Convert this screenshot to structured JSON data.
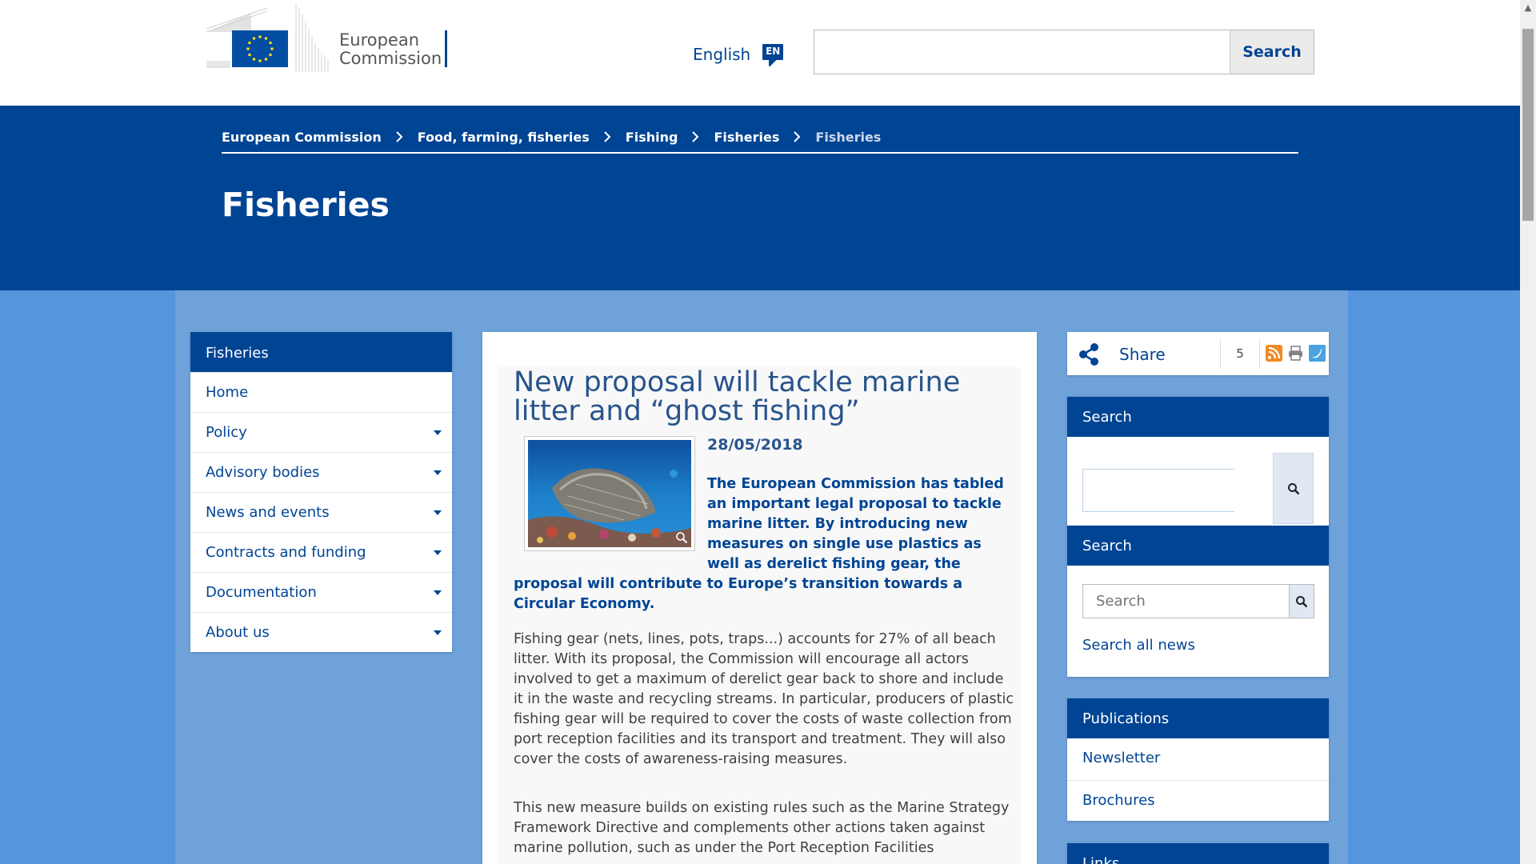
{
  "header": {
    "logo_line1": "European",
    "logo_line2": "Commission",
    "language": "English",
    "language_code": "EN",
    "search_button": "Search",
    "search_value": ""
  },
  "breadcrumb": [
    "European Commission",
    "Food, farming, fisheries",
    "Fishing",
    "Fisheries",
    "Fisheries"
  ],
  "page_title": "Fisheries",
  "sidenav": {
    "heading": "Fisheries",
    "items": [
      {
        "label": "Home",
        "expandable": false
      },
      {
        "label": "Policy",
        "expandable": true
      },
      {
        "label": "Advisory bodies",
        "expandable": true
      },
      {
        "label": "News and events",
        "expandable": true
      },
      {
        "label": "Contracts and funding",
        "expandable": true
      },
      {
        "label": "Documentation",
        "expandable": true
      },
      {
        "label": "About us",
        "expandable": true
      }
    ]
  },
  "article": {
    "title": "New proposal will tackle marine litter and “ghost fishing”",
    "date": "28/05/2018",
    "lead": "The European Commission has tabled an important legal proposal to tackle marine litter. By introducing new measures on single use plastics as well as derelict fishing gear, the proposal will contribute to Europe’s transition towards a Circular Economy.",
    "p1": "Fishing gear (nets, lines, pots, traps...) accounts for 27% of all beach litter. With its proposal, the Commission will encourage all actors involved to get a maximum of derelict gear back to shore and include it in the waste and recycling streams. In particular, producers of plastic fishing gear will be required to cover the costs of waste collection from port reception facilities and its transport and treatment. They will also cover the costs of awareness-raising measures.",
    "p2": "This new measure builds on existing rules such as the Marine Strategy Framework Directive and complements other actions taken against marine pollution, such as under the Port Reception Facilities"
  },
  "share": {
    "label": "Share",
    "count": "5"
  },
  "search_panel_1": {
    "heading": "Search",
    "value": ""
  },
  "search_panel_2": {
    "heading": "Search",
    "placeholder": "Search",
    "link": "Search all news"
  },
  "publications": {
    "heading": "Publications",
    "items": [
      "Newsletter",
      "Brochures"
    ]
  },
  "links": {
    "heading": "Links"
  },
  "colors": {
    "brand_blue": "#004494",
    "content_bg": "#5595dd",
    "title_blue": "#28548d"
  },
  "icons": [
    "eu-flag-icon",
    "language-bubble-icon",
    "chevron-right-icon",
    "caret-down-icon",
    "share-icon",
    "rss-icon",
    "print-icon",
    "twitter-icon",
    "magnifier-icon",
    "zoom-icon"
  ]
}
